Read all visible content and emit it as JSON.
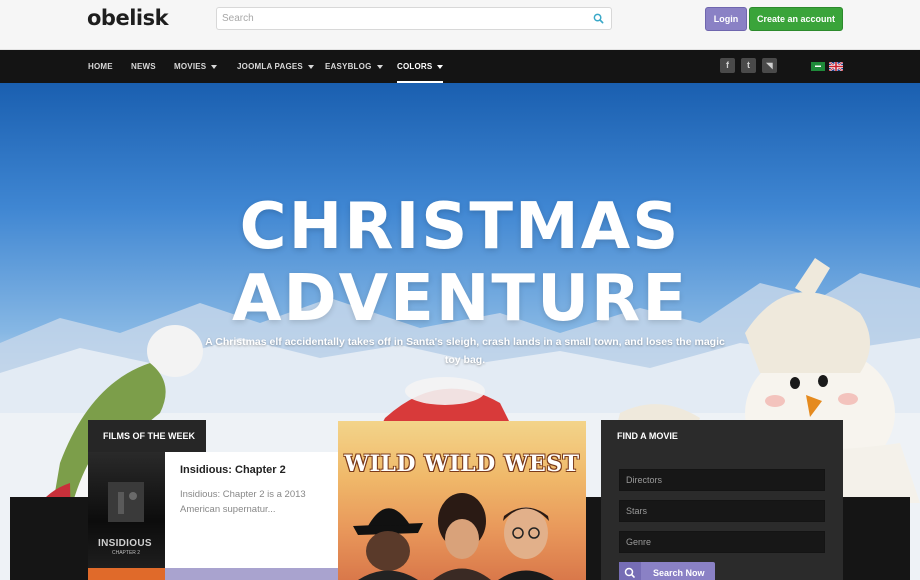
{
  "header": {
    "logo": "obelisk",
    "search_placeholder": "Search",
    "login_label": "Login",
    "create_account_label": "Create an account"
  },
  "nav": {
    "items": [
      {
        "label": "HOME"
      },
      {
        "label": "NEWS"
      },
      {
        "label": "MOVIES"
      },
      {
        "label": "JOOMLA PAGES"
      },
      {
        "label": "EASYBLOG"
      },
      {
        "label": "COLORS"
      }
    ],
    "social": [
      {
        "icon": "facebook-icon",
        "glyph": "f"
      },
      {
        "icon": "twitter-icon",
        "glyph": "t"
      },
      {
        "icon": "rss-icon",
        "glyph": "◥"
      }
    ],
    "languages": [
      "arabic-flag-icon",
      "english-flag-icon"
    ]
  },
  "hero": {
    "title_line1": "CHRISTMAS",
    "title_line2": "ADVENTURE",
    "subtitle": "A Christmas elf accidentally takes off in Santa's sleigh, crash lands in a small town, and loses the magic toy bag."
  },
  "films_of_week": {
    "tab_label": "FILMS OF THE WEEK",
    "title": "Insidious: Chapter 2",
    "description": "Insidious: Chapter 2 is a 2013 American supernatur...",
    "poster_text": "INSIDIOUS",
    "poster_chapter": "CHAPTER 2"
  },
  "featured": {
    "poster_title": "WILD WILD WEST"
  },
  "find_movie": {
    "heading": "FIND A MOVIE",
    "directors_placeholder": "Directors",
    "stars_placeholder": "Stars",
    "genre_placeholder": "Genre",
    "search_label": "Search Now"
  },
  "colors": {
    "login": "#8a81c5",
    "create_account": "#3aa43a",
    "nav_bg": "#141414"
  }
}
